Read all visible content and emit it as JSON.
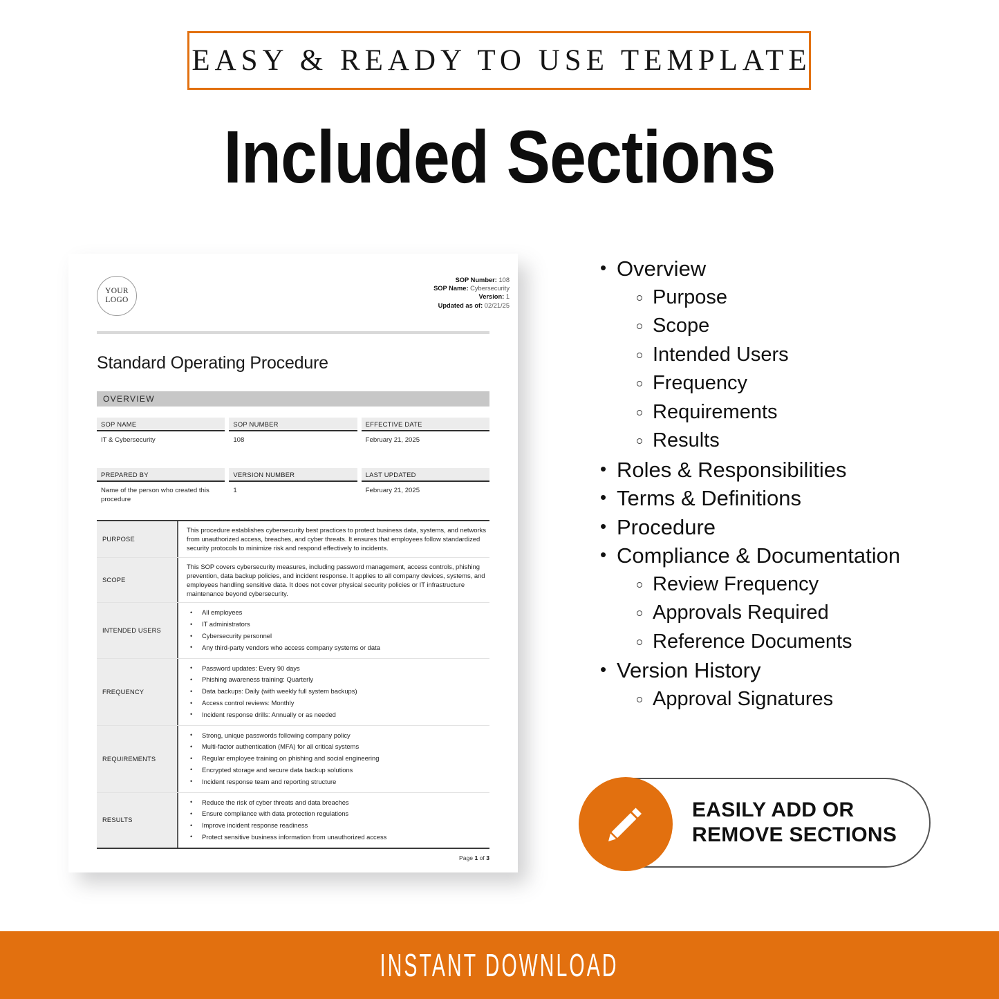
{
  "top_banner": {
    "text": "EASY & READY TO USE TEMPLATE",
    "border_color": "#E2700F"
  },
  "page_title": "Included Sections",
  "document": {
    "logo": {
      "line1": "YOUR",
      "line2": "LOGO"
    },
    "meta": {
      "sop_number_label": "SOP Number:",
      "sop_number_value": "108",
      "sop_name_label": "SOP Name:",
      "sop_name_value": "Cybersecurity",
      "version_label": "Version:",
      "version_value": "1",
      "updated_label": "Updated as of:",
      "updated_value": "02/21/25"
    },
    "title": "Standard Operating Procedure",
    "section_band": "OVERVIEW",
    "info_row_1": [
      {
        "label": "SOP NAME",
        "value": "IT & Cybersecurity"
      },
      {
        "label": "SOP NUMBER",
        "value": "108"
      },
      {
        "label": "EFFECTIVE DATE",
        "value": "February 21, 2025"
      }
    ],
    "info_row_2": [
      {
        "label": "PREPARED BY",
        "value": "Name of the person who created this procedure"
      },
      {
        "label": "VERSION NUMBER",
        "value": "1"
      },
      {
        "label": "LAST UPDATED",
        "value": "February 21, 2025"
      }
    ],
    "rows": [
      {
        "label": "PURPOSE",
        "paragraph": "This procedure establishes cybersecurity best practices to protect business data, systems, and networks from unauthorized access, breaches, and cyber threats. It ensures that employees follow standardized security protocols to minimize risk and respond effectively to incidents."
      },
      {
        "label": "SCOPE",
        "paragraph": "This SOP covers cybersecurity measures, including password management, access controls, phishing prevention, data backup policies, and incident response. It applies to all company devices, systems, and employees handling sensitive data. It does not cover physical security policies or IT infrastructure maintenance beyond cybersecurity."
      },
      {
        "label": "INTENDED USERS",
        "bullets": [
          "All employees",
          "IT administrators",
          "Cybersecurity personnel",
          "Any third-party vendors who access company systems or data"
        ]
      },
      {
        "label": "FREQUENCY",
        "bullets": [
          "Password updates: Every 90 days",
          "Phishing awareness training: Quarterly",
          "Data backups: Daily (with weekly full system backups)",
          "Access control reviews: Monthly",
          "Incident response drills: Annually or as needed"
        ]
      },
      {
        "label": "REQUIREMENTS",
        "bullets": [
          "Strong, unique passwords following company policy",
          "Multi-factor authentication (MFA) for all critical systems",
          "Regular employee training on phishing and social engineering",
          "Encrypted storage and secure data backup solutions",
          "Incident response team and reporting structure"
        ]
      },
      {
        "label": "RESULTS",
        "bullets": [
          "Reduce the risk of cyber threats and data breaches",
          "Ensure compliance with data protection regulations",
          "Improve incident response readiness",
          "Protect sensitive business information from unauthorized access"
        ]
      }
    ],
    "footer": {
      "prefix": "Page ",
      "page": "1",
      "middle": " of ",
      "total": "3"
    }
  },
  "sections_list": [
    {
      "level": 1,
      "label": "Overview"
    },
    {
      "level": 2,
      "label": "Purpose"
    },
    {
      "level": 2,
      "label": "Scope"
    },
    {
      "level": 2,
      "label": "Intended Users"
    },
    {
      "level": 2,
      "label": "Frequency"
    },
    {
      "level": 2,
      "label": "Requirements"
    },
    {
      "level": 2,
      "label": "Results"
    },
    {
      "level": 1,
      "label": "Roles & Responsibilities"
    },
    {
      "level": 1,
      "label": "Terms & Definitions"
    },
    {
      "level": 1,
      "label": "Procedure"
    },
    {
      "level": 1,
      "label": "Compliance & Documentation"
    },
    {
      "level": 2,
      "label": "Review Frequency"
    },
    {
      "level": 2,
      "label": "Approvals Required"
    },
    {
      "level": 2,
      "label": "Reference Documents"
    },
    {
      "level": 1,
      "label": "Version History"
    },
    {
      "level": 2,
      "label": "Approval Signatures"
    }
  ],
  "pill_badge": {
    "line1": "EASILY ADD OR",
    "line2": "REMOVE SECTIONS",
    "icon": "pencil-icon",
    "circle_color": "#E2700F"
  },
  "bottom_banner": {
    "text": "INSTANT DOWNLOAD",
    "background": "#E2700F"
  }
}
